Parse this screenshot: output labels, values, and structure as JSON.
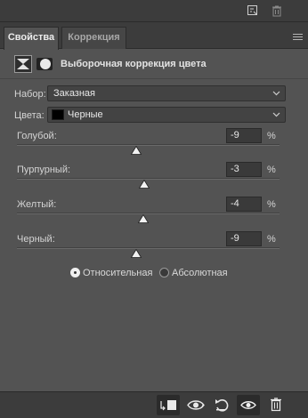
{
  "tabs": [
    {
      "label": "Свойства",
      "active": true
    },
    {
      "label": "Коррекция",
      "active": false
    }
  ],
  "panel": {
    "title": "Выборочная коррекция цвета"
  },
  "preset": {
    "label": "Набор:",
    "value": "Заказная"
  },
  "colors": {
    "label": "Цвета:",
    "value": "Черные",
    "swatch": "#000000"
  },
  "sliders": [
    {
      "label": "Голубой:",
      "value": "-9",
      "unit": "%",
      "level": -9
    },
    {
      "label": "Пурпурный:",
      "value": "-3",
      "unit": "%",
      "level": -3
    },
    {
      "label": "Желтый:",
      "value": "-4",
      "unit": "%",
      "level": -4
    },
    {
      "label": "Черный:",
      "value": "-9",
      "unit": "%",
      "level": -9
    }
  ],
  "method": {
    "options": [
      {
        "label": "Относительная",
        "checked": true
      },
      {
        "label": "Абсолютная",
        "checked": false
      }
    ]
  },
  "icons": {
    "top": [
      "new-layer-icon",
      "trash-icon"
    ],
    "bottom": [
      "clip-to-layer-icon",
      "view-previous-state-icon",
      "reset-icon",
      "visibility-eye-icon",
      "trash-icon"
    ]
  }
}
